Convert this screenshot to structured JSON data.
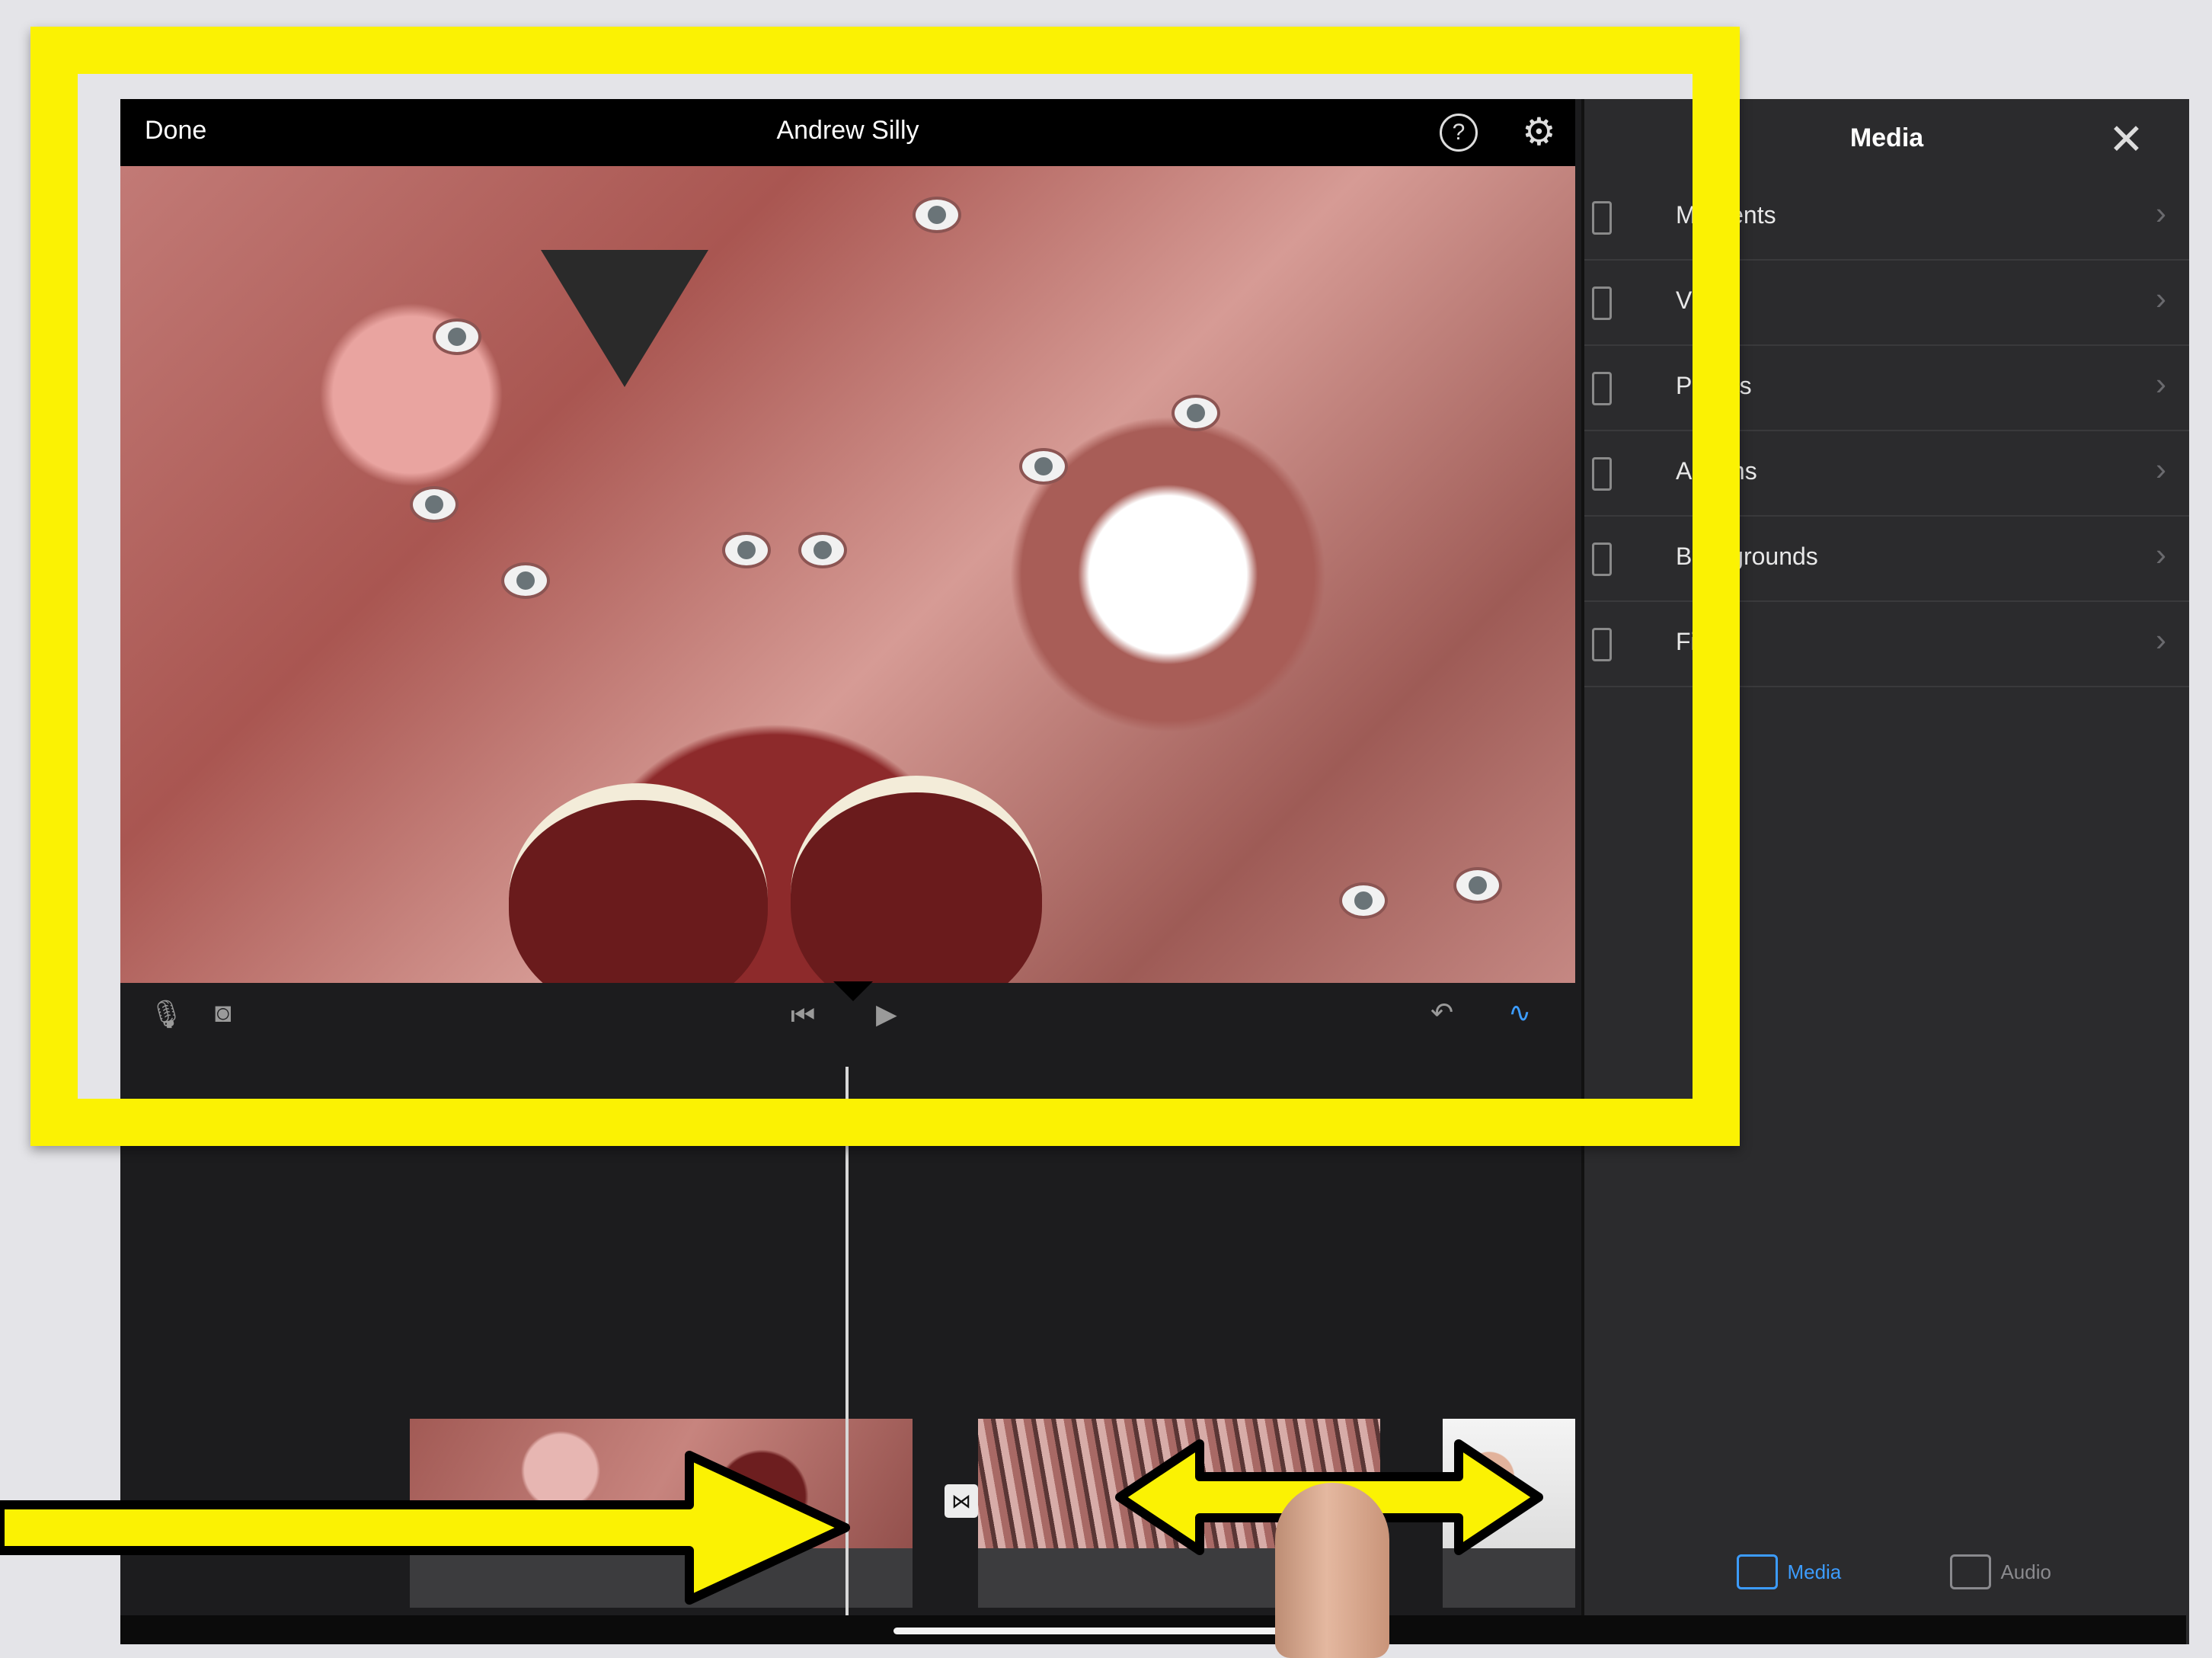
{
  "header": {
    "done_label": "Done",
    "title": "Andrew Silly",
    "help_icon": "question-circle-icon",
    "settings_icon": "gear-icon"
  },
  "viewer_controls": {
    "left": [
      "microphone-icon",
      "camera-icon"
    ],
    "center": [
      "skip-to-start-icon",
      "play-icon"
    ],
    "right": [
      "undo-icon",
      "audio-waveform-icon"
    ]
  },
  "timeline": {
    "clips": [
      {
        "name": "kaleidoscope-clip",
        "thumbnail": "kaleidoscope-face"
      },
      {
        "name": "radial-zoom-clip",
        "thumbnail": "radial-stretch-face"
      },
      {
        "name": "portrait-clip",
        "thumbnail": "man-smiling"
      }
    ],
    "transition_icon": "bowtie-icon"
  },
  "media_panel": {
    "title": "Media",
    "close_icon": "close-icon",
    "items": [
      {
        "label": "Moments"
      },
      {
        "label": "Video"
      },
      {
        "label": "Photos"
      },
      {
        "label": "Albums"
      },
      {
        "label": "Backgrounds"
      },
      {
        "label": "Files"
      }
    ],
    "tabs": [
      {
        "label": "Media",
        "active": true
      },
      {
        "label": "Audio",
        "active": false
      }
    ]
  },
  "colors": {
    "highlight": "#fbf203",
    "accent": "#3c9cff",
    "panel_bg": "#2b2b2d",
    "app_bg": "#1c1c1e"
  }
}
